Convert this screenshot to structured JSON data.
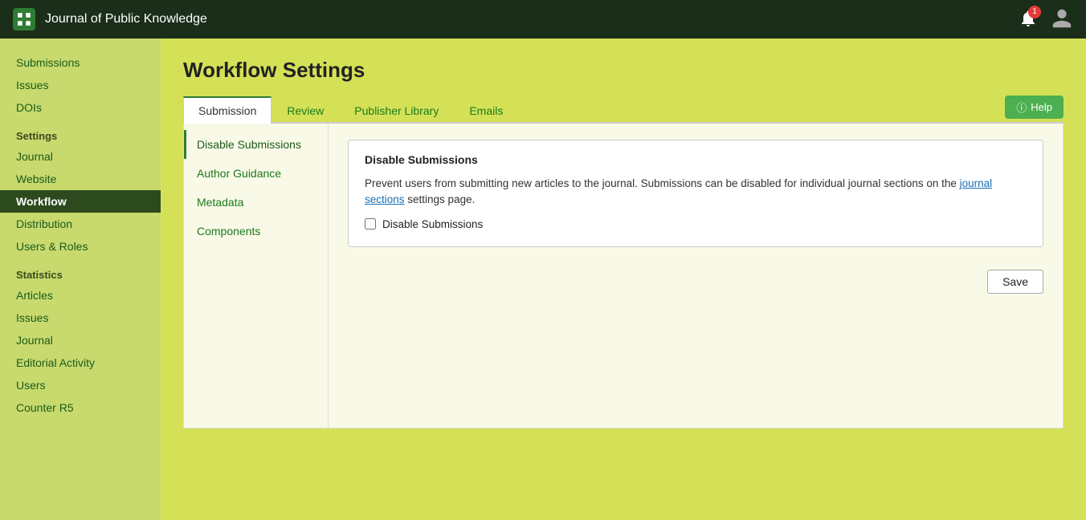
{
  "topnav": {
    "logo_icon": "grid-icon",
    "title": "Journal of Public Knowledge",
    "bell_count": "1",
    "user_icon": "user-icon"
  },
  "sidebar": {
    "items_top": [
      {
        "label": "Submissions",
        "id": "submissions"
      },
      {
        "label": "Issues",
        "id": "issues"
      },
      {
        "label": "DOIs",
        "id": "dois"
      }
    ],
    "settings_section": "Settings",
    "settings_items": [
      {
        "label": "Journal",
        "id": "journal"
      },
      {
        "label": "Website",
        "id": "website"
      },
      {
        "label": "Workflow",
        "id": "workflow",
        "active": true
      },
      {
        "label": "Distribution",
        "id": "distribution"
      },
      {
        "label": "Users & Roles",
        "id": "users-roles"
      }
    ],
    "statistics_section": "Statistics",
    "statistics_items": [
      {
        "label": "Articles",
        "id": "stat-articles"
      },
      {
        "label": "Issues",
        "id": "stat-issues"
      },
      {
        "label": "Journal",
        "id": "stat-journal"
      },
      {
        "label": "Editorial Activity",
        "id": "stat-editorial"
      },
      {
        "label": "Users",
        "id": "stat-users"
      },
      {
        "label": "Counter R5",
        "id": "stat-counter"
      }
    ]
  },
  "page": {
    "title": "Workflow Settings",
    "tabs": [
      {
        "label": "Submission",
        "id": "submission",
        "active": true
      },
      {
        "label": "Review",
        "id": "review"
      },
      {
        "label": "Publisher Library",
        "id": "publisher-library"
      },
      {
        "label": "Emails",
        "id": "emails"
      }
    ],
    "help_label": "Help"
  },
  "side_nav": {
    "items": [
      {
        "label": "Disable Submissions",
        "id": "disable-submissions",
        "active": true
      },
      {
        "label": "Author Guidance",
        "id": "author-guidance"
      },
      {
        "label": "Metadata",
        "id": "metadata"
      },
      {
        "label": "Components",
        "id": "components"
      }
    ]
  },
  "section": {
    "fieldset_title": "Disable Submissions",
    "description_part1": "Prevent users from submitting new articles to the journal. Submissions can be disabled for individual journal sections on the ",
    "description_link": "journal sections",
    "description_part2": " settings page.",
    "checkbox_label": "Disable Submissions",
    "save_button": "Save"
  }
}
